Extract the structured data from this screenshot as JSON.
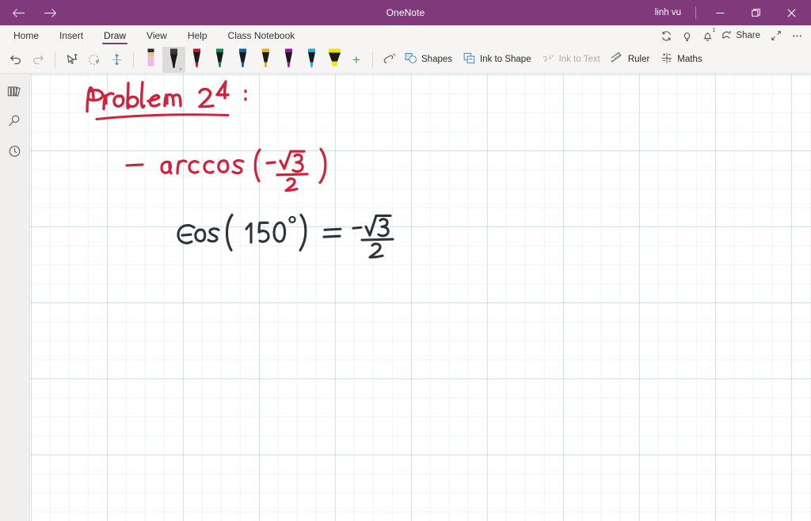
{
  "titlebar": {
    "app_title": "OneNote",
    "user": "linh vu",
    "back_icon": "arrow-left-icon",
    "forward_icon": "arrow-right-icon",
    "minimize_label": "Minimize",
    "restore_label": "Restore",
    "close_label": "Close"
  },
  "menubar": {
    "tabs": [
      {
        "label": "Home",
        "active": false
      },
      {
        "label": "Insert",
        "active": false
      },
      {
        "label": "Draw",
        "active": true
      },
      {
        "label": "View",
        "active": false
      },
      {
        "label": "Help",
        "active": false
      },
      {
        "label": "Class Notebook",
        "active": false
      }
    ],
    "active_tab": "Draw",
    "accent_color": "#80397b",
    "right_actions": [
      {
        "name": "sync-icon",
        "label": "Sync"
      },
      {
        "name": "lightbulb-icon",
        "label": "Tell me what you want to do"
      },
      {
        "name": "notifications-icon",
        "label": "Notifications",
        "badge": "1"
      },
      {
        "name": "share-icon",
        "label": "Share"
      },
      {
        "name": "fullscreen-icon",
        "label": "Full screen"
      },
      {
        "name": "more-options-icon",
        "label": "More options"
      }
    ],
    "share_label": "Share"
  },
  "toolbar": {
    "undo_label": "Undo",
    "redo_label": "Redo",
    "lasso_select_label": "Lasso Select",
    "lasso_add_label": "Ink Select",
    "space_label": "Insert Space",
    "pens": [
      {
        "name": "pencil",
        "body": "#f1b8e4",
        "tip": "#e8c27a",
        "cap": "#2b2b2b",
        "selected": false
      },
      {
        "name": "pen-black",
        "body": "#1a1a1a",
        "tip": "#1a1a1a",
        "cap": "#3a3a3a",
        "selected": true
      },
      {
        "name": "pen-red",
        "body": "#c8102e",
        "tip": "#c8102e",
        "cap": "#1a1a1a",
        "selected": false
      },
      {
        "name": "pen-green",
        "body": "#0f8a4d",
        "tip": "#0f8a4d",
        "cap": "#1a1a1a",
        "selected": false
      },
      {
        "name": "pen-blue",
        "body": "#1160a8",
        "tip": "#1160a8",
        "cap": "#1a1a1a",
        "selected": false
      },
      {
        "name": "pen-gold",
        "body": "#e8a820",
        "tip": "#e8a820",
        "cap": "#1a1a1a",
        "selected": false
      },
      {
        "name": "pen-magenta",
        "body": "#a6159c",
        "tip": "#a6159c",
        "cap": "#1a1a1a",
        "selected": false
      },
      {
        "name": "pen-cyan",
        "body": "#1fa8e0",
        "tip": "#1fa8e0",
        "cap": "#1a1a1a",
        "selected": false
      }
    ],
    "highlighter": {
      "name": "highlighter-yellow",
      "body": "#f5e400",
      "cap": "#1a1a1a"
    },
    "add_pen_label": "+",
    "eraser_label": "Eraser",
    "commands": [
      {
        "label": "Shapes",
        "icon": "shapes-icon",
        "disabled": false
      },
      {
        "label": "Ink to Shape",
        "icon": "ink-to-shape-icon",
        "disabled": false
      },
      {
        "label": "Ink to Text",
        "icon": "ink-to-text-icon",
        "disabled": true
      },
      {
        "label": "Ruler",
        "icon": "ruler-icon",
        "disabled": false
      },
      {
        "label": "Maths",
        "icon": "maths-icon",
        "disabled": false
      }
    ]
  },
  "rail": {
    "items": [
      {
        "name": "notebooks-icon",
        "label": "Show Notebooks"
      },
      {
        "name": "search-icon",
        "label": "Search"
      },
      {
        "name": "recent-icon",
        "label": "Recent Notes"
      }
    ]
  },
  "canvas": {
    "grid": "small grid",
    "ink_notes": [
      {
        "text": "Problem 24 :",
        "color": "#d0223b",
        "underlined": true
      },
      {
        "text": "— arccos(−√3/2)",
        "color": "#d0223b",
        "underlined": false
      },
      {
        "text": "Cos(150°) = −√3/2",
        "color": "#2e3338",
        "underlined": false
      }
    ],
    "ink_red": "#d0223b",
    "ink_black": "#2e3338"
  }
}
